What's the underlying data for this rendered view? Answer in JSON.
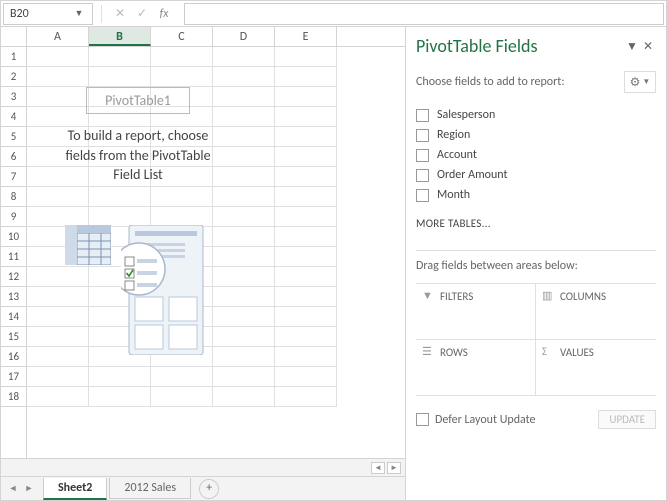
{
  "name_box": "B20",
  "columns": [
    "A",
    "B",
    "C",
    "D",
    "E"
  ],
  "active_col": 1,
  "rows": [
    1,
    2,
    3,
    4,
    5,
    6,
    7,
    8,
    9,
    10,
    11,
    12,
    13,
    14,
    15,
    16,
    17,
    18
  ],
  "pivot_placeholder": {
    "title": "PivotTable1",
    "desc_line1": "To build a report, choose",
    "desc_line2": "fields from the PivotTable",
    "desc_line3": "Field List"
  },
  "sheet_tabs": {
    "active": "Sheet2",
    "other": "2012 Sales"
  },
  "task_pane": {
    "title": "PivotTable Fields",
    "subtitle": "Choose fields to add to report:",
    "fields": [
      "Salesperson",
      "Region",
      "Account",
      "Order Amount",
      "Month"
    ],
    "more_tables": "MORE TABLES...",
    "drag_label": "Drag fields between areas below:",
    "areas": {
      "filters": "FILTERS",
      "columns": "COLUMNS",
      "rows": "ROWS",
      "values": "VALUES"
    },
    "defer_label": "Defer Layout Update",
    "update": "UPDATE"
  }
}
